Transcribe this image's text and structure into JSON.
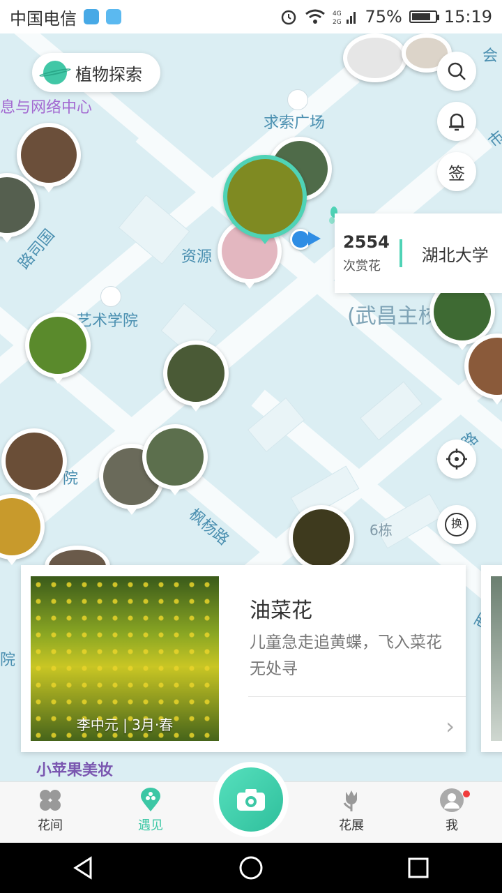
{
  "status": {
    "carrier": "中国电信",
    "battery": "75%",
    "time": "15:19",
    "network": "4G 2G"
  },
  "map": {
    "chip_label": "植物探索",
    "labels": {
      "info_center": "息与网络中心",
      "qiusuo": "求索广场",
      "ziyuan": "资源",
      "art": "艺术学院",
      "wuchang": "(武昌主校",
      "fengyang": "枫杨路",
      "building6": "6栋",
      "road_left": "路司国",
      "yuan": "院",
      "yuan2": "院",
      "shop": "小苹果美妆",
      "lu_right": "路",
      "xi": "西",
      "shi": "市",
      "hui": "会"
    },
    "info": {
      "count": "2554",
      "unit": "次赏花",
      "name": "湖北大学"
    },
    "buttons": {
      "search": "search",
      "bell": "bell",
      "sign": "签",
      "locate": "locate",
      "switch": "换"
    }
  },
  "card": {
    "title": "油菜花",
    "description": "儿童急走追黄蝶，飞入菜花无处寻",
    "credit": "李中元 | 3月·春"
  },
  "tabs": [
    {
      "label": "花间"
    },
    {
      "label": "遇见"
    },
    {
      "label": ""
    },
    {
      "label": "花展"
    },
    {
      "label": "我"
    }
  ],
  "colors": {
    "accent": "#3cc7a5",
    "map_bg": "#dbeef3",
    "road": "#f7fbfc"
  }
}
